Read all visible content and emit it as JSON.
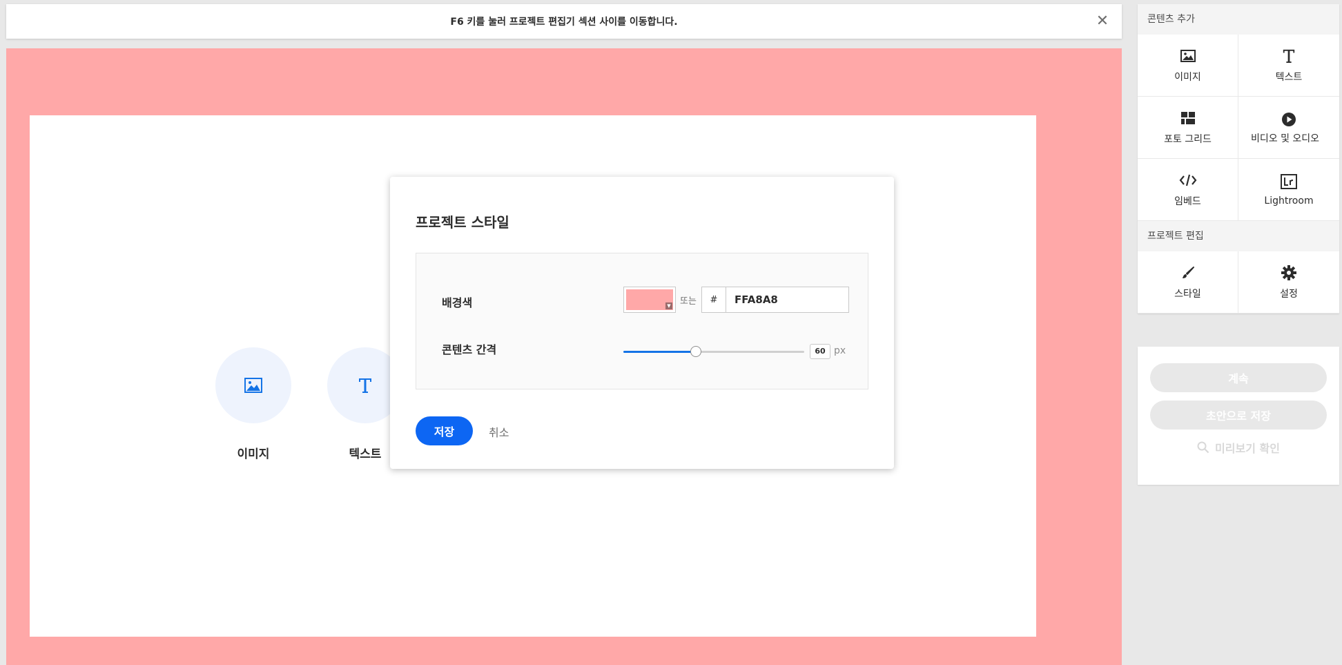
{
  "notice": {
    "message": "F6 키를 눌러 프로젝트 편집기 섹션 사이를 이동합니다.",
    "close_glyph": "✕"
  },
  "canvas": {
    "background_color": "#FFA8A8",
    "start_items": [
      {
        "label": "이미지",
        "icon": "image-icon"
      },
      {
        "label": "텍스트",
        "icon": "text-icon"
      }
    ]
  },
  "modal": {
    "title": "프로젝트 스타일",
    "background_label": "배경색",
    "or_text": "또는",
    "hex_hash": "#",
    "hex_value": "FFA8A8",
    "spacing_label": "콘텐츠 간격",
    "spacing_value": "60",
    "spacing_unit": "px",
    "spacing_fraction": 0.4,
    "save_label": "저장",
    "cancel_label": "취소"
  },
  "sidebar": {
    "add_content_title": "콘텐츠 추가",
    "add_content_items": [
      {
        "label": "이미지",
        "icon": "image-icon"
      },
      {
        "label": "텍스트",
        "icon": "text-icon"
      },
      {
        "label": "포토 그리드",
        "icon": "photo-grid-icon"
      },
      {
        "label": "비디오 및 오디오",
        "icon": "play-icon"
      },
      {
        "label": "임베드",
        "icon": "embed-code-icon"
      },
      {
        "label": "Lightroom",
        "icon": "lightroom-icon"
      }
    ],
    "edit_project_title": "프로젝트 편집",
    "edit_project_items": [
      {
        "label": "스타일",
        "icon": "brush-icon"
      },
      {
        "label": "설정",
        "icon": "gear-icon"
      }
    ],
    "continue_label": "계속",
    "save_draft_label": "초안으로 저장",
    "preview_label": "미리보기 확인"
  },
  "colors": {
    "accent": "#0d66f3",
    "canvas_bg": "#FFA8A8"
  }
}
